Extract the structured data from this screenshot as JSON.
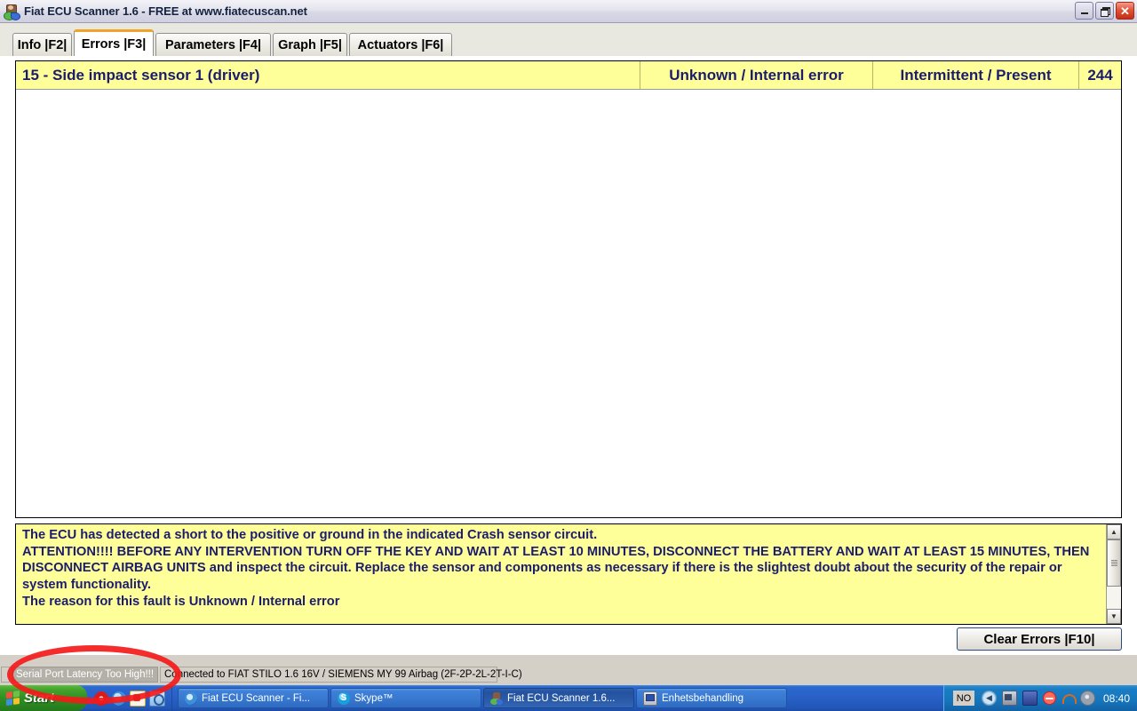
{
  "window": {
    "title": "Fiat ECU Scanner 1.6 - FREE at www.fiatecuscan.net",
    "icon": "fiat-ecu-scanner-icon",
    "minimize_label": "Minimize",
    "restore_label": "Restore",
    "close_label": "✕"
  },
  "tabs": [
    {
      "label": "Info |F2|",
      "active": false
    },
    {
      "label": "Errors |F3|",
      "active": true
    },
    {
      "label": "Parameters |F4|",
      "active": false
    },
    {
      "label": "Graph |F5|",
      "active": false
    },
    {
      "label": "Actuators |F6|",
      "active": false
    }
  ],
  "errors": {
    "rows": [
      {
        "name": "15 - Side impact sensor 1 (driver)",
        "cause": "Unknown / Internal error",
        "status": "Intermittent / Present",
        "count": "244"
      }
    ]
  },
  "description": {
    "lines": [
      "The ECU has detected a short to the positive or ground in the indicated Crash sensor circuit.",
      "ATTENTION!!!! BEFORE ANY INTERVENTION TURN OFF THE KEY AND WAIT AT LEAST 10 MINUTES, DISCONNECT THE BATTERY AND WAIT AT LEAST 15 MINUTES, THEN DISCONNECT AIRBAG UNITS and inspect the circuit. Replace the sensor and components as necessary if there is the slightest doubt about the security of the repair or system functionality.",
      "The reason for this fault is Unknown / Internal error"
    ],
    "scroll_up_glyph": "▲",
    "scroll_down_glyph": "▼"
  },
  "actions": {
    "clear_errors_label": "Clear Errors |F10|"
  },
  "statusbar": {
    "warning": "Serial Port Latency Too High!!!",
    "connection": "Connected to FIAT STILO 1.6 16V / SIEMENS MY 99 Airbag (2F-2P-2L-2T-I-C)"
  },
  "taskbar": {
    "start_label": "Start",
    "quicklaunch": [
      {
        "icon": "opera-icon"
      },
      {
        "icon": "internet-explorer-icon"
      },
      {
        "icon": "acrobat-icon"
      },
      {
        "icon": "windows-explorer-icon"
      }
    ],
    "items": [
      {
        "label": "Fiat ECU Scanner - Fi...",
        "icon": "internet-explorer-icon",
        "active": false
      },
      {
        "label": "Skype™",
        "icon": "skype-icon",
        "active": false
      },
      {
        "label": "Fiat ECU Scanner 1.6...",
        "icon": "fiat-ecu-scanner-icon",
        "active": true
      },
      {
        "label": "Enhetsbehandling",
        "icon": "device-manager-icon",
        "active": false
      }
    ],
    "tray": {
      "language": "NO",
      "clock": "08:40",
      "icons": [
        "show-hidden-icons-arrow-icon",
        "network-icon",
        "battery-icon",
        "safely-remove-hardware-icon",
        "wireless-icon",
        "disc-icon"
      ]
    }
  },
  "annotation": {
    "shape": "red-ellipse-highlight",
    "color": "#F31A1A",
    "targets": "Serial Port Latency Too High!!!"
  }
}
